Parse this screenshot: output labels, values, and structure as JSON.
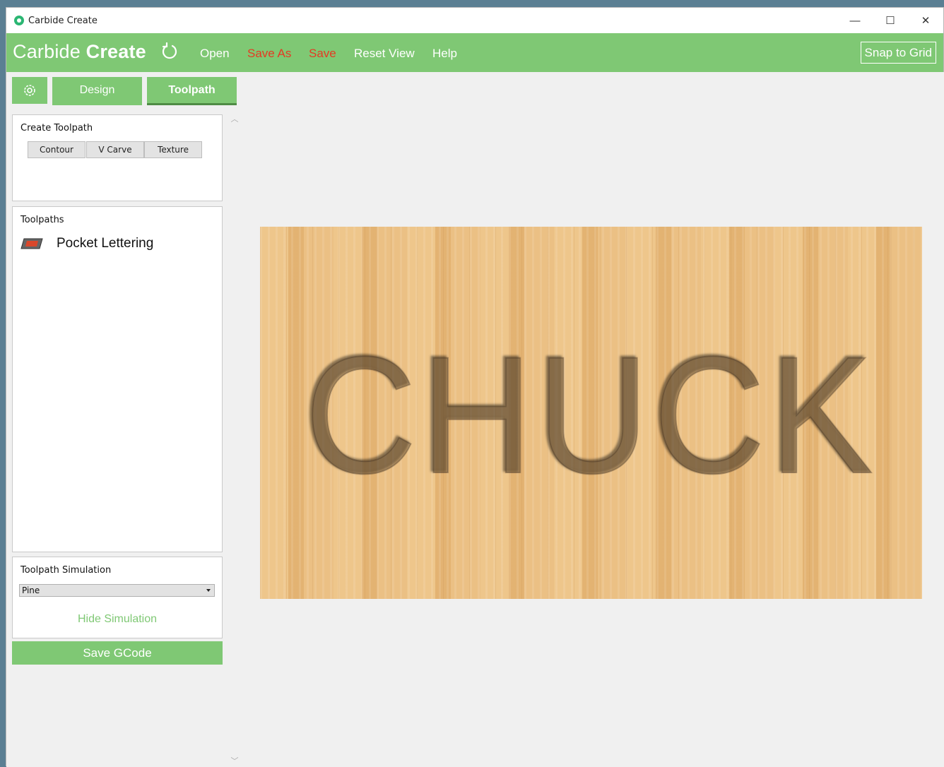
{
  "window": {
    "title": "Carbide Create"
  },
  "window_controls": {
    "minimize": "—",
    "maximize": "☐",
    "close": "✕"
  },
  "menubar": {
    "brand_light": "Carbide",
    "brand_bold": "Create",
    "items": [
      {
        "label": "Open",
        "color": "#ffffff"
      },
      {
        "label": "Save As",
        "color": "#e53a23"
      },
      {
        "label": "Save",
        "color": "#e53a23"
      },
      {
        "label": "Reset View",
        "color": "#ffffff"
      },
      {
        "label": "Help",
        "color": "#ffffff"
      }
    ],
    "snap_label": "Snap to Grid"
  },
  "tabs": {
    "design": "Design",
    "toolpath": "Toolpath",
    "active": "Toolpath"
  },
  "create_toolpath": {
    "title": "Create Toolpath",
    "buttons": [
      "Contour",
      "V Carve",
      "Texture"
    ]
  },
  "toolpaths": {
    "title": "Toolpaths",
    "items": [
      {
        "label": "Pocket Lettering",
        "icon": "pocket-icon"
      }
    ]
  },
  "simulation": {
    "title": "Toolpath Simulation",
    "material": "Pine",
    "hide_label": "Hide Simulation"
  },
  "save_gcode_label": "Save GCode",
  "canvas": {
    "carved_text": "CHUCK"
  },
  "colors": {
    "accent": "#7fc874",
    "warning": "#e53a23"
  }
}
